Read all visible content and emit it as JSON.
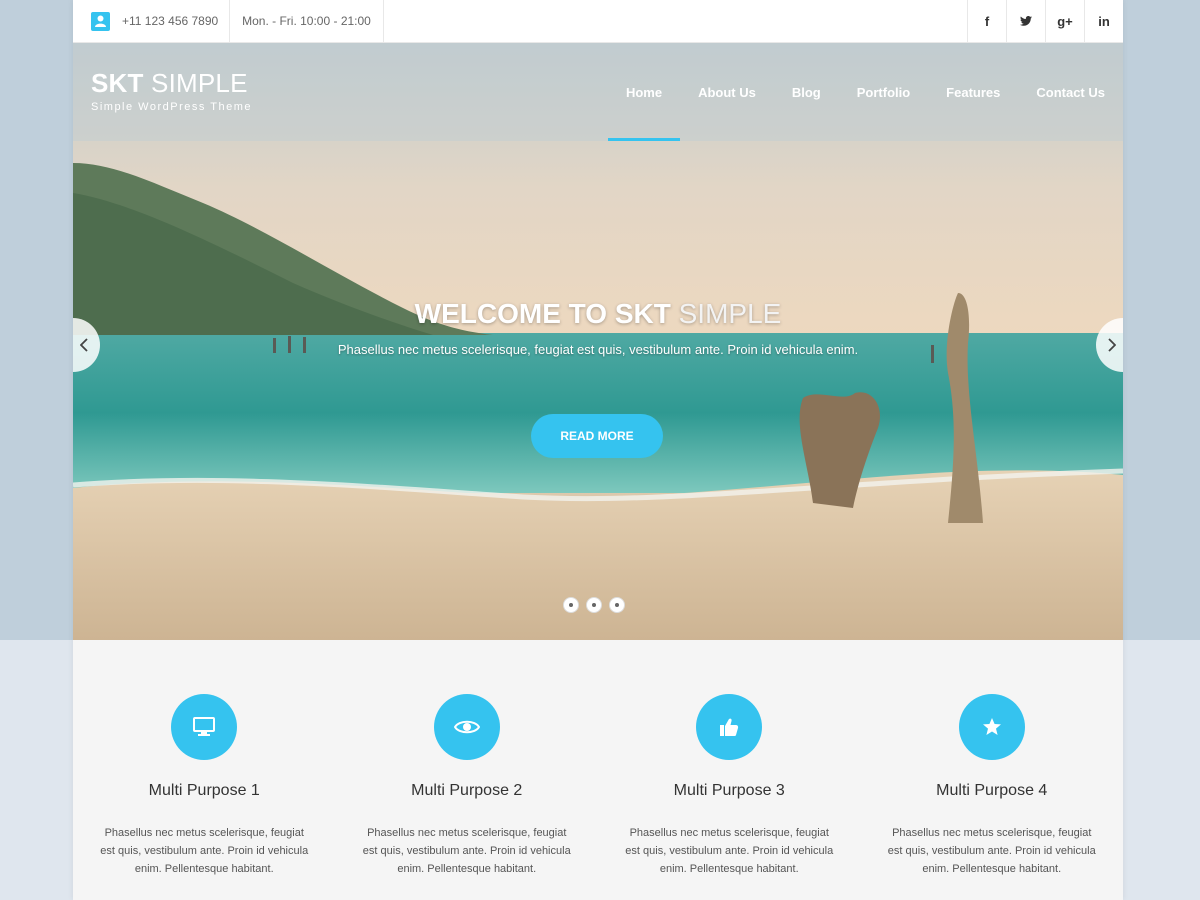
{
  "topbar": {
    "phone": "+11 123 456 7890",
    "hours": "Mon. - Fri. 10:00 - 21:00",
    "social": [
      "f",
      "t",
      "g+",
      "in"
    ]
  },
  "logo": {
    "bold": "SKT",
    "thin": "SIMPLE",
    "tagline": "Simple WordPress Theme"
  },
  "nav": {
    "items": [
      "Home",
      "About Us",
      "Blog",
      "Portfolio",
      "Features",
      "Contact Us"
    ],
    "active": "Home"
  },
  "slider": {
    "title_bold": "WELCOME TO SKT",
    "title_thin": "SIMPLE",
    "description": "Phasellus nec metus scelerisque, feugiat est quis, vestibulum ante. Proin id vehicula enim.",
    "button": "READ MORE",
    "slide_count": 3
  },
  "features": [
    {
      "title": "Multi Purpose 1",
      "icon": "monitor-icon",
      "text": "Phasellus nec metus scelerisque, feugiat est quis, vestibulum ante. Proin id vehicula enim. Pellentesque habitant."
    },
    {
      "title": "Multi Purpose 2",
      "icon": "eye-icon",
      "text": "Phasellus nec metus scelerisque, feugiat est quis, vestibulum ante. Proin id vehicula enim. Pellentesque habitant."
    },
    {
      "title": "Multi Purpose 3",
      "icon": "thumbs-up-icon",
      "text": "Phasellus nec metus scelerisque, feugiat est quis, vestibulum ante. Proin id vehicula enim. Pellentesque habitant."
    },
    {
      "title": "Multi Purpose 4",
      "icon": "star-icon",
      "text": "Phasellus nec metus scelerisque, feugiat est quis, vestibulum ante. Proin id vehicula enim. Pellentesque habitant."
    }
  ],
  "colors": {
    "accent": "#35c3ef",
    "page_bg": "#bfcfdb"
  }
}
